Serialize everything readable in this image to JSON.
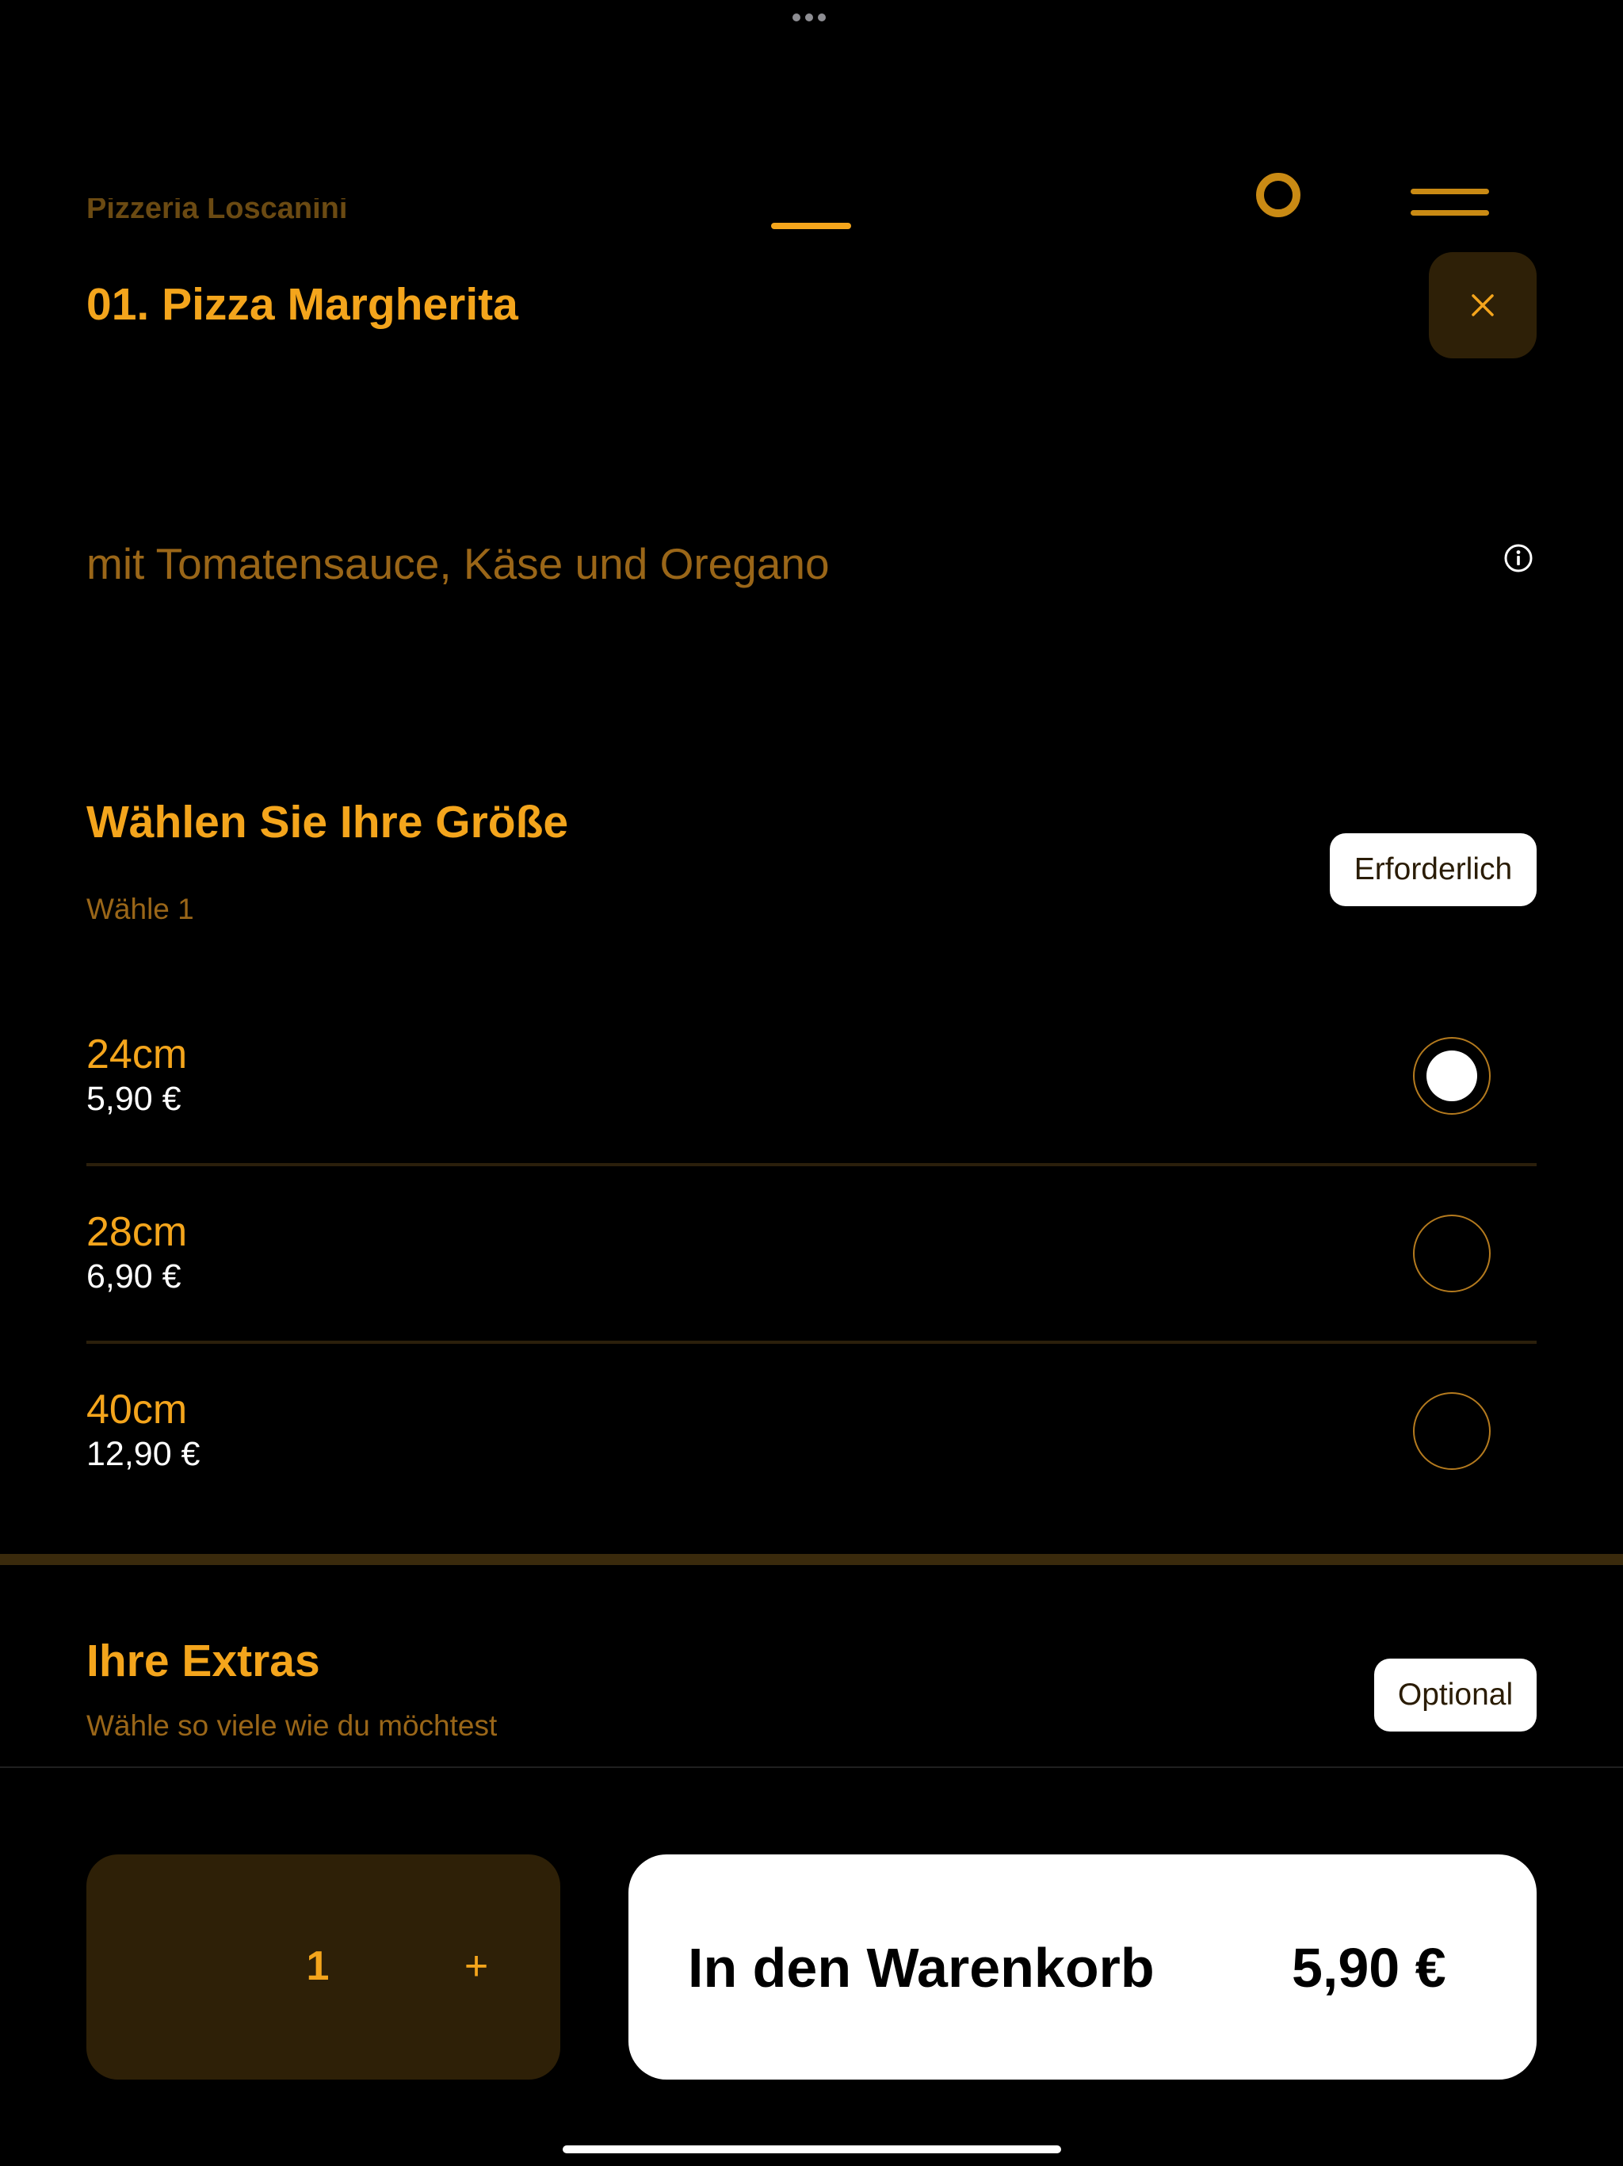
{
  "brand": "Pizzeria Loscanini",
  "product": {
    "title": "01. Pizza Margherita",
    "description": "mit Tomatensauce, Käse und Oregano"
  },
  "size_section": {
    "title": "Wählen Sie Ihre Größe",
    "subtitle": "Wähle 1",
    "badge": "Erforderlich",
    "options": [
      {
        "name": "24cm",
        "price": "5,90 €",
        "selected": true
      },
      {
        "name": "28cm",
        "price": "6,90 €",
        "selected": false
      },
      {
        "name": "40cm",
        "price": "12,90 €",
        "selected": false
      }
    ]
  },
  "extras_section": {
    "title": "Ihre Extras",
    "subtitle": "Wähle so viele wie du möchtest",
    "badge": "Optional"
  },
  "footer": {
    "quantity": "1",
    "plus": "+",
    "cart_label": "In den Warenkorb",
    "cart_price": "5,90 €"
  },
  "icons": {
    "close": "close-icon",
    "info": "info-icon",
    "menu": "menu-icon",
    "profile": "profile-icon"
  },
  "colors": {
    "accent": "#f4a51c",
    "muted_accent": "#9a6618",
    "dark_panel": "#2e2007",
    "background": "#000000"
  }
}
